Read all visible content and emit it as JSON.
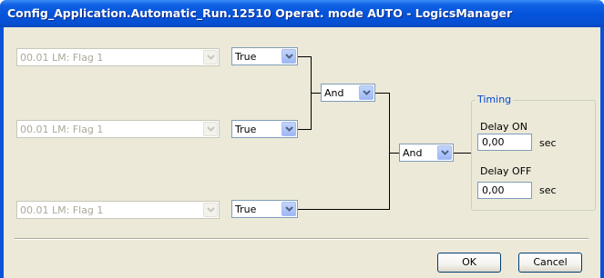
{
  "window": {
    "title": "Config_Application.Automatic_Run.12510 Operat. mode AUTO - LogicsManager"
  },
  "inputs": [
    {
      "source": "00.01 LM: Flag 1",
      "operator": "True"
    },
    {
      "source": "00.01 LM: Flag 1",
      "operator": "True"
    },
    {
      "source": "00.01 LM: Flag 1",
      "operator": "True"
    }
  ],
  "gates": [
    {
      "value": "And"
    },
    {
      "value": "And"
    }
  ],
  "timing": {
    "title": "Timing",
    "delay_on_label": "Delay ON",
    "delay_on_value": "0,00",
    "delay_on_unit": "sec",
    "delay_off_label": "Delay OFF",
    "delay_off_value": "0,00",
    "delay_off_unit": "sec"
  },
  "buttons": {
    "ok": "OK",
    "cancel": "Cancel"
  },
  "colors": {
    "titlebar": "#0553DB",
    "dialog_bg": "#ECE9D8",
    "group_label": "#0046D5",
    "disabled_text": "#ACA899"
  }
}
